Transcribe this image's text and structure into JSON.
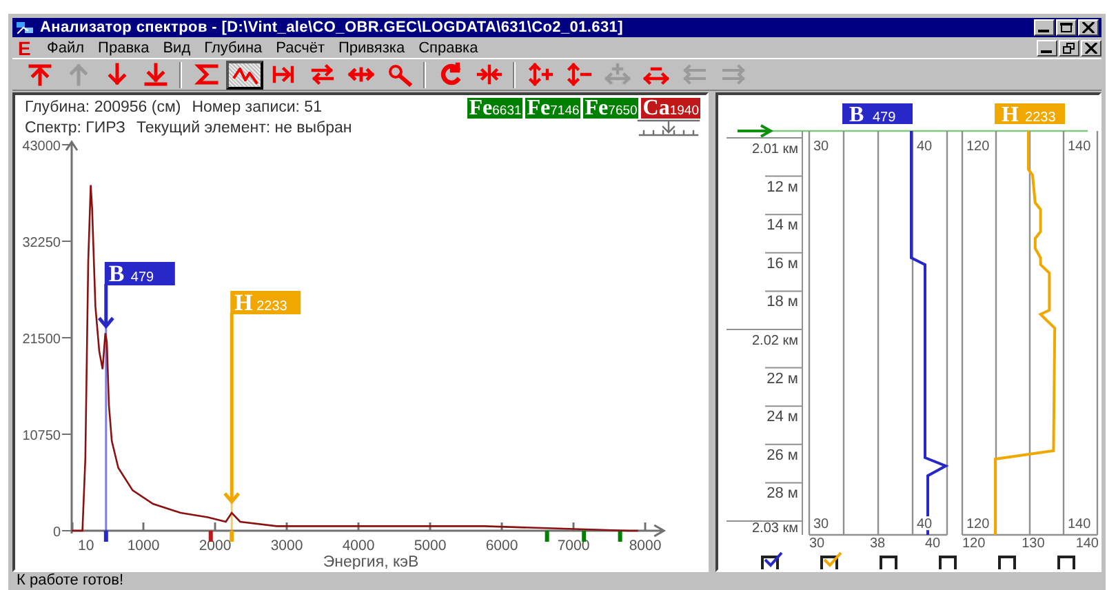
{
  "window": {
    "title": "Анализатор спектров - [D:\\Vint_ale\\CO_OBR.GEC\\LOGDATA\\631\\Co2_01.631]"
  },
  "menu_bar": {
    "child_icon_letter": "E",
    "items": [
      {
        "label": "Файл"
      },
      {
        "label": "Правка"
      },
      {
        "label": "Вид"
      },
      {
        "label": "Глубина"
      },
      {
        "label": "Расчёт"
      },
      {
        "label": "Привязка"
      },
      {
        "label": "Справка"
      }
    ]
  },
  "toolbar": [
    {
      "kind": "button",
      "disabled": false,
      "pressed": false
    },
    {
      "kind": "button",
      "disabled": true,
      "pressed": false
    },
    {
      "kind": "button",
      "disabled": false,
      "pressed": false
    },
    {
      "kind": "button",
      "disabled": false,
      "pressed": false
    },
    {
      "kind": "separator"
    },
    {
      "kind": "button",
      "disabled": false,
      "pressed": false
    },
    {
      "kind": "button",
      "disabled": false,
      "pressed": true
    },
    {
      "kind": "button",
      "disabled": false,
      "pressed": false
    },
    {
      "kind": "button",
      "disabled": false,
      "pressed": false
    },
    {
      "kind": "button",
      "disabled": false,
      "pressed": false
    },
    {
      "kind": "button",
      "disabled": false,
      "pressed": false
    },
    {
      "kind": "separator"
    },
    {
      "kind": "button",
      "disabled": false,
      "pressed": false
    },
    {
      "kind": "button",
      "disabled": false,
      "pressed": false
    },
    {
      "kind": "separator"
    },
    {
      "kind": "button",
      "disabled": false,
      "pressed": false
    },
    {
      "kind": "button",
      "disabled": false,
      "pressed": false
    },
    {
      "kind": "button",
      "disabled": true,
      "pressed": false
    },
    {
      "kind": "button",
      "disabled": false,
      "pressed": false
    },
    {
      "kind": "button",
      "disabled": true,
      "pressed": false
    },
    {
      "kind": "button",
      "disabled": true,
      "pressed": false
    }
  ],
  "spectrum_pane": {
    "depth": "Глубина: 200956 (см)",
    "record": "Номер записи: 51",
    "spectrum": "Спектр: ГИРЗ",
    "current_element": "Текущий элемент: не выбран",
    "element_badges": [
      {
        "symbol": "Fe",
        "energy": "6631",
        "color": "#008000"
      },
      {
        "symbol": "Fe",
        "energy": "7146",
        "color": "#008000"
      },
      {
        "symbol": "Fe",
        "energy": "7650",
        "color": "#008000"
      },
      {
        "symbol": "Ca",
        "energy": "1940",
        "color": "#c01818"
      }
    ],
    "markers": [
      {
        "symbol": "B",
        "energy": "479",
        "color": "#2828c8"
      },
      {
        "symbol": "H",
        "energy": "2233",
        "color": "#f0a800"
      }
    ],
    "chart_data": {
      "type": "line",
      "xlabel": "Энергия, кэВ",
      "x": [
        0,
        150,
        190,
        230,
        265,
        285,
        330,
        385,
        430,
        470,
        490,
        520,
        560,
        650,
        850,
        1135,
        1520,
        1900,
        2150,
        2233,
        2350,
        2860,
        3830,
        5750,
        7770,
        7900
      ],
      "series": [
        {
          "color": "#8b1010",
          "values": [
            0,
            0,
            8000,
            30000,
            38500,
            36000,
            25000,
            20000,
            18000,
            22000,
            21000,
            14000,
            10000,
            7000,
            4500,
            3000,
            2000,
            1500,
            1000,
            2000,
            1000,
            500,
            500,
            500,
            0,
            0
          ]
        }
      ],
      "xlim": [
        0,
        8300
      ],
      "ylim": [
        0,
        43000
      ],
      "xticks": [
        {
          "value": 10,
          "label": "10"
        },
        1000,
        2000,
        3000,
        4000,
        5000,
        6000,
        7000,
        8000
      ],
      "yticks": [
        0,
        10750,
        21500,
        32250,
        43000
      ],
      "ref_lines": [
        {
          "axis": "x",
          "value": 479
        },
        {
          "axis": "x",
          "value": 2233
        }
      ]
    }
  },
  "log_pane": {
    "depth_scale": [
      {
        "text": "2.01 км",
        "kind": "major"
      },
      {
        "text": "12 м",
        "kind": "minor"
      },
      {
        "text": "14 м",
        "kind": "minor"
      },
      {
        "text": "16 м",
        "kind": "minor"
      },
      {
        "text": "18 м",
        "kind": "minor"
      },
      {
        "text": "2.02 км",
        "kind": "major"
      },
      {
        "text": "22 м",
        "kind": "minor"
      },
      {
        "text": "24 м",
        "kind": "minor"
      },
      {
        "text": "26 м",
        "kind": "minor"
      },
      {
        "text": "28 м",
        "kind": "minor"
      },
      {
        "text": "2.03 км",
        "kind": "major"
      }
    ],
    "tracks": [
      {
        "symbol": "B",
        "energy": "479",
        "color": "#2828c8",
        "top_labels": [
          "30",
          "40"
        ],
        "inner_bottom_labels": [
          "30",
          "40"
        ],
        "axis_labels": [
          "30",
          "38",
          "40"
        ]
      },
      {
        "symbol": "H",
        "energy": "2233",
        "color": "#f0a800",
        "top_labels": [
          "120",
          "140"
        ],
        "inner_bottom_labels": [
          "120",
          "140"
        ],
        "axis_labels": [
          "120",
          "130",
          "140"
        ]
      }
    ],
    "checkboxes": [
      {
        "checked": true,
        "color": "#2828c8"
      },
      {
        "checked": true,
        "color": "#f0a800"
      },
      {
        "checked": false
      },
      {
        "checked": false
      },
      {
        "checked": false
      },
      {
        "checked": false
      }
    ]
  },
  "status_bar": "К работе готов!"
}
